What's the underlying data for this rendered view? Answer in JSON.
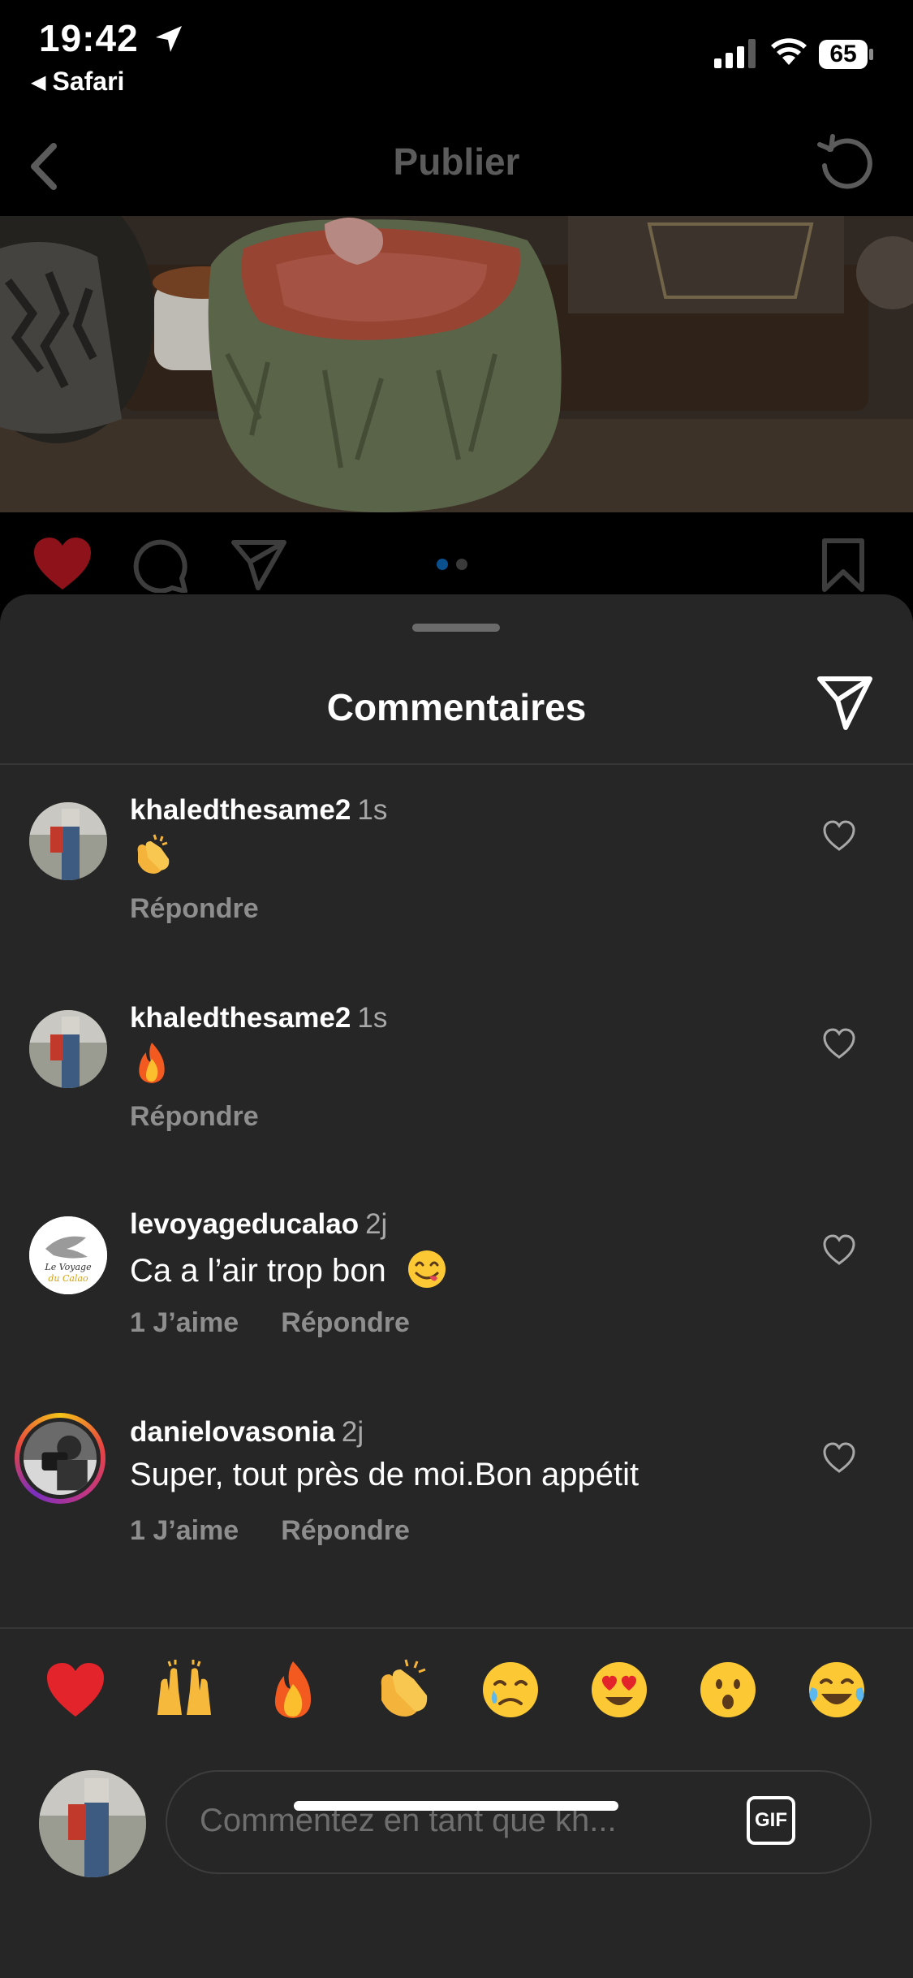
{
  "status_bar": {
    "time": "19:42",
    "back_app": "Safari",
    "battery": "65"
  },
  "navbar": {
    "title": "Publier"
  },
  "carousel": {
    "pages": 2,
    "active": 1
  },
  "sheet": {
    "title": "Commentaires"
  },
  "comments": [
    {
      "user": "khaledthesame2",
      "time": "1s",
      "emoji": "clapping-hands",
      "actions": [
        "Répondre"
      ]
    },
    {
      "user": "khaledthesame2",
      "time": "1s",
      "emoji": "fire",
      "actions": [
        "Répondre"
      ]
    },
    {
      "user": "levoyageducalao",
      "time": "2j",
      "text": "Ca a l’air trop bon",
      "emoji": "face-savoring-food",
      "actions": [
        "1 J’aime",
        "Répondre"
      ]
    },
    {
      "user": "danielovasonia",
      "time": "2j",
      "text": "Super, tout près de moi.Bon appétit",
      "actions": [
        "1 J’aime",
        "Répondre"
      ]
    }
  ],
  "emoji_bar": [
    "red-heart",
    "raising-hands",
    "fire",
    "clapping-hands",
    "crying-face",
    "heart-eyes",
    "astonished-face",
    "tears-of-joy"
  ],
  "composer": {
    "placeholder": "Commentez en tant que kh...",
    "gif_label": "GIF"
  },
  "colors": {
    "sheet_bg": "#262626",
    "like_red": "#b3151f",
    "dot_active": "#0a5fa8"
  }
}
